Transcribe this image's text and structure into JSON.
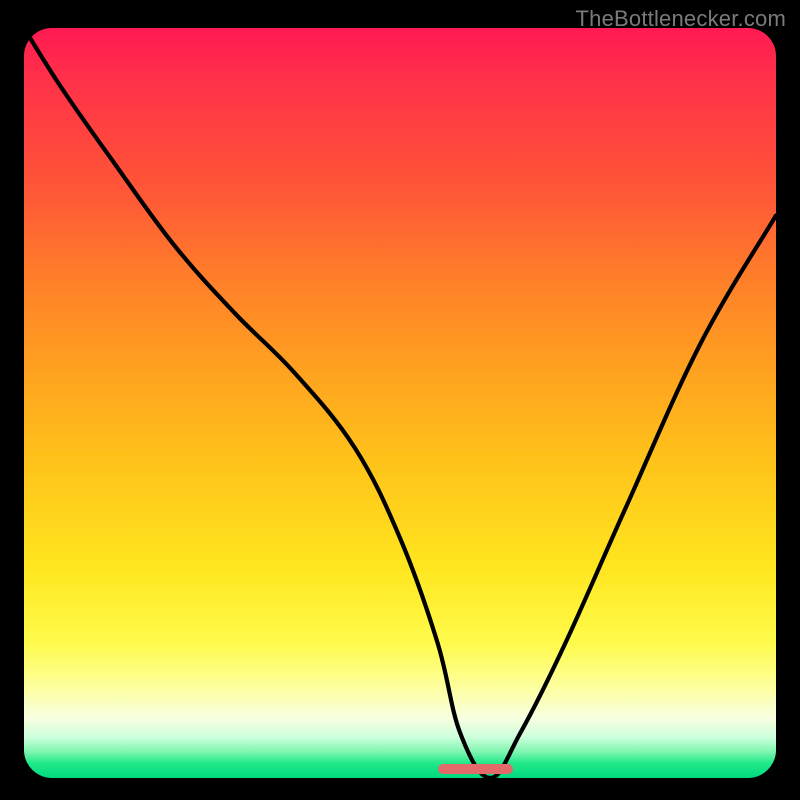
{
  "watermark": {
    "text": "TheBottlenecker.com"
  },
  "chart_data": {
    "type": "line",
    "title": "",
    "xlabel": "",
    "ylabel": "",
    "xlim": [
      0,
      100
    ],
    "ylim": [
      0,
      100
    ],
    "x": [
      0,
      5,
      12,
      20,
      28,
      36,
      44,
      50,
      55,
      58,
      62,
      66,
      72,
      80,
      90,
      100
    ],
    "values": [
      100,
      92,
      82,
      71,
      62,
      54,
      44,
      32,
      18,
      6,
      0,
      6,
      18,
      36,
      58,
      75
    ],
    "optimal_band": {
      "x_start": 55,
      "x_end": 65,
      "color": "#e46a6a"
    },
    "gradient_scale": {
      "top": "bottleneck-high",
      "bottom": "bottleneck-none",
      "colors": [
        "#ff1a52",
        "#ffa020",
        "#ffe61f",
        "#00d97e"
      ]
    }
  }
}
